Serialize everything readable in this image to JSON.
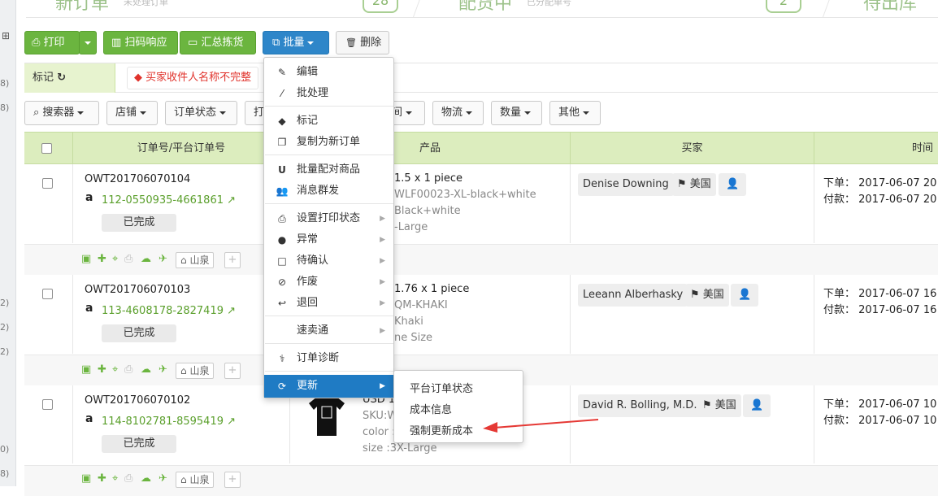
{
  "left_counts": [
    "8)",
    "8)",
    "2)",
    "2)",
    "2)",
    "0)",
    "8)"
  ],
  "top_stats": [
    {
      "title": "新订单",
      "sub": "未处理订单",
      "count": "28"
    },
    {
      "title": "配货中",
      "sub": "已分配单号",
      "count": "2"
    },
    {
      "title": "待出库",
      "sub": ""
    }
  ],
  "toolbar": {
    "print": "打印",
    "scan": "扫码响应",
    "summary": "汇总拣货",
    "batch": "批量",
    "delete": "删除"
  },
  "tagbar": {
    "mark": "标记",
    "buyer_incomplete": "买家收件人名称不完整"
  },
  "filters": [
    {
      "label": "搜索器"
    },
    {
      "label": "店铺"
    },
    {
      "label": "订单状态"
    },
    {
      "label": "打"
    },
    {
      "label": "间"
    },
    {
      "label": "物流"
    },
    {
      "label": "数量"
    },
    {
      "label": "其他"
    }
  ],
  "table": {
    "headers": {
      "order": "订单号/平台订单号",
      "product": "产品",
      "buyer": "买家",
      "time": "时间"
    },
    "rows": [
      {
        "order_no": "OWT201706070104",
        "platform_no": "112-0550935-4661861",
        "status": "已完成",
        "warehouse": "山泉",
        "product": [
          "1.5 x 1 piece",
          "WLF00023-XL-black+white",
          "Black+white",
          "-Large"
        ],
        "buyer": "Denise Downing",
        "country": "美国",
        "order_label": "下单：",
        "order_time": "2017-06-07 20",
        "pay_label": "付款：",
        "pay_time": "2017-06-07 20"
      },
      {
        "order_no": "OWT201706070103",
        "platform_no": "113-4608178-2827419",
        "status": "已完成",
        "warehouse": "山泉",
        "product": [
          "1.76 x 1 piece",
          "QM-KHAKI",
          "Khaki",
          "ne Size"
        ],
        "buyer": "Leeann Alberhasky",
        "country": "美国",
        "order_label": "下单：",
        "order_time": "2017-06-07 16",
        "pay_label": "付款：",
        "pay_time": "2017-06-07 16"
      },
      {
        "order_no": "OWT201706070102",
        "platform_no": "114-8102781-8595419",
        "status": "已完成",
        "warehouse": "山泉",
        "product": [
          "USD 1",
          "SKU:W",
          "color :",
          "size :3X-Large"
        ],
        "buyer": "David R. Bolling, M.D.",
        "country": "美国",
        "order_label": "下单：",
        "order_time": "2017-06-07 10",
        "pay_label": "付款：",
        "pay_time": "2017-06-07 10"
      }
    ]
  },
  "menu": {
    "items": [
      "编辑",
      "批处理",
      "标记",
      "复制为新订单",
      "批量配对商品",
      "消息群发",
      "设置打印状态",
      "异常",
      "待确认",
      "作废",
      "退回",
      "速卖通",
      "订单诊断",
      "更新"
    ],
    "icons": [
      "edit-icon",
      "magic-icon",
      "tag-icon",
      "copy-icon",
      "magnet-icon",
      "users-icon",
      "print-icon",
      "alert-icon",
      "checkbox-icon",
      "ban-icon",
      "reply-icon",
      "none",
      "stethoscope-icon",
      "refresh-icon"
    ]
  },
  "submenu": {
    "items": [
      "平台订单状态",
      "成本信息",
      "强制更新成本"
    ]
  },
  "colors": {
    "green": "#6bb53f",
    "blue": "#2e86c9",
    "arrow": "#e53935",
    "highlight": "#1f7bc4"
  }
}
